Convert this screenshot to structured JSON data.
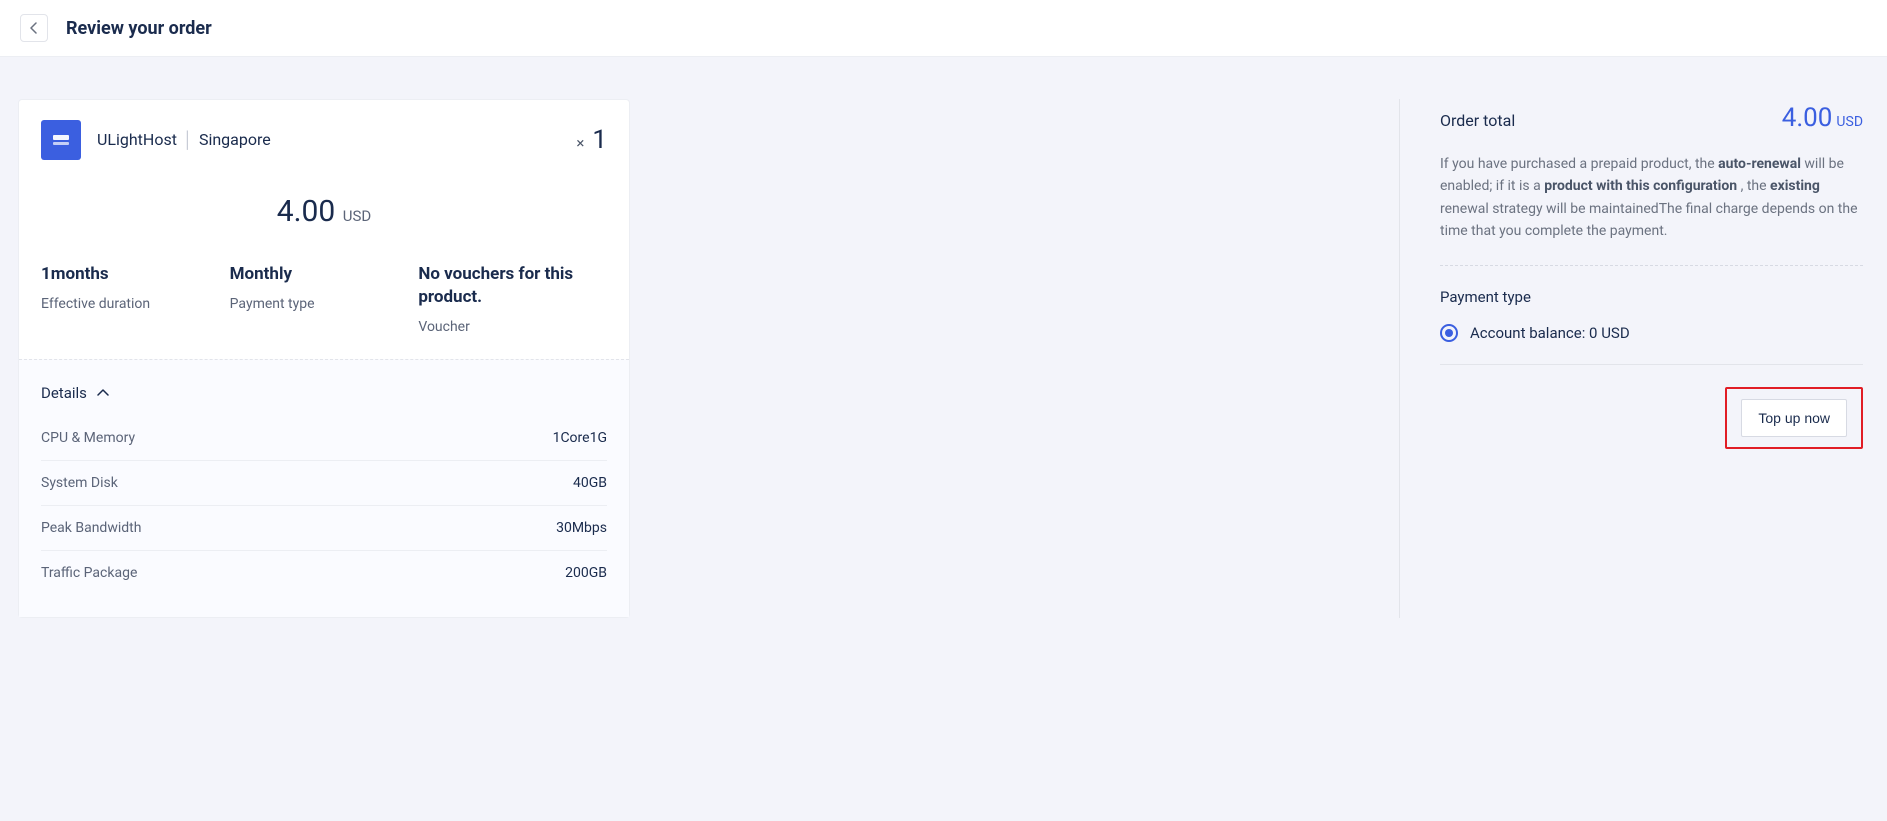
{
  "header": {
    "title": "Review your order"
  },
  "product": {
    "name": "ULightHost",
    "region": "Singapore",
    "quantity": "1",
    "price": "4.00",
    "currency": "USD"
  },
  "meta": {
    "duration_value": "1months",
    "duration_label": "Effective duration",
    "payment_value": "Monthly",
    "payment_label": "Payment type",
    "voucher_value": "No vouchers for this product.",
    "voucher_label": "Voucher"
  },
  "details": {
    "toggle_label": "Details",
    "specs": [
      {
        "label": "CPU & Memory",
        "value": "1Core1G"
      },
      {
        "label": "System Disk",
        "value": "40GB"
      },
      {
        "label": "Peak Bandwidth",
        "value": "30Mbps"
      },
      {
        "label": "Traffic Package",
        "value": "200GB"
      }
    ]
  },
  "summary": {
    "order_total_label": "Order total",
    "order_total_amount": "4.00",
    "order_total_currency": "USD",
    "notice": {
      "p1": "If you have purchased a prepaid product, the ",
      "b1": "auto-renewal",
      "p2": " will be enabled; if it is a ",
      "b2": "product with this configuration",
      "p3": " , the ",
      "b3": "existing",
      "p4": " renewal strategy will be maintainedThe final charge depends on the time that you complete the payment."
    },
    "payment_type_label": "Payment type",
    "balance_label": "Account balance: 0 USD",
    "topup_label": "Top up now"
  }
}
